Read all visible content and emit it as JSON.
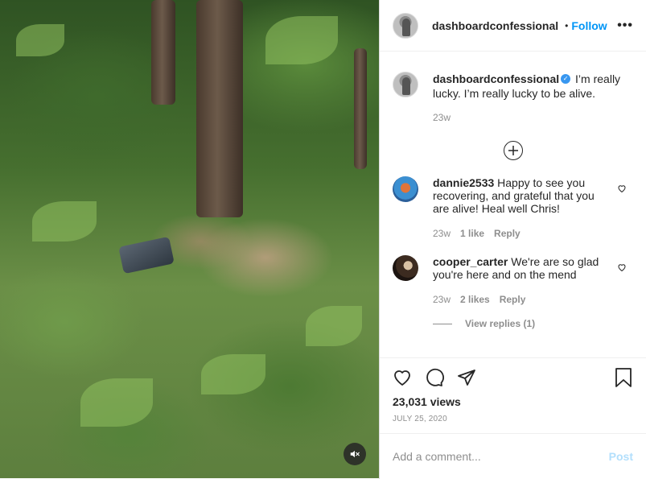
{
  "post": {
    "username": "dashboardconfessional",
    "follow_label": "Follow",
    "dot": "•",
    "more_label": "•••",
    "caption": {
      "username": "dashboardconfessional",
      "verified_mark": "✓",
      "text": "I’m really lucky. I’m really lucky to be alive.",
      "time": "23w"
    }
  },
  "comments": [
    {
      "username": "dannie2533",
      "text": "Happy to see you recovering, and grateful that you are alive! Heal well Chris!",
      "time": "23w",
      "likes": "1 like",
      "reply_label": "Reply"
    },
    {
      "username": "cooper_carter",
      "text": "We're are so glad you're here and on the mend",
      "time": "23w",
      "likes": "2 likes",
      "reply_label": "Reply",
      "view_replies": "View replies (1)"
    }
  ],
  "stats": {
    "views": "23,031 views",
    "date": "JULY 25, 2020"
  },
  "composer": {
    "placeholder": "Add a comment...",
    "post_label": "Post"
  },
  "colors": {
    "accent": "#0095f6",
    "post_disabled": "#b2dffc",
    "verified": "#3897f0"
  }
}
